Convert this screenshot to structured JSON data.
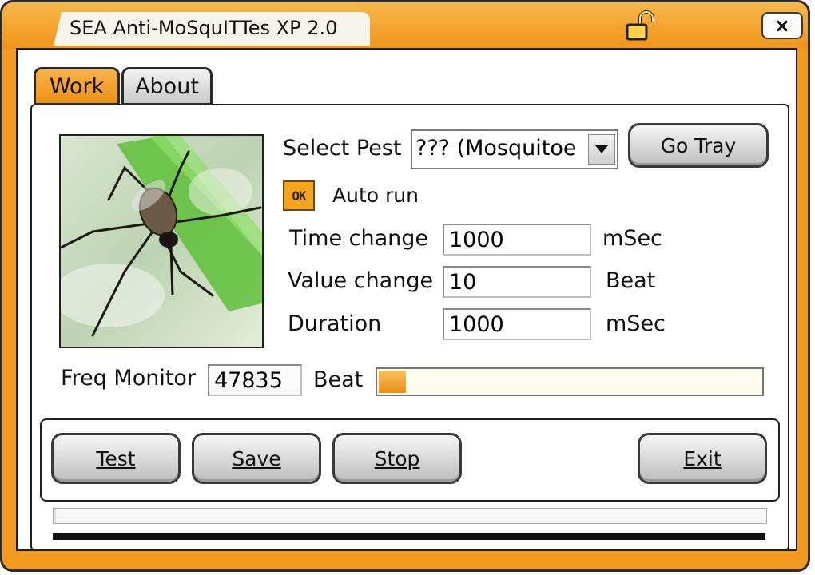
{
  "window": {
    "title": "SEA Anti-MoSquITTes XP 2.0",
    "close_label": "×"
  },
  "tabs": [
    {
      "label": "Work",
      "selected": true
    },
    {
      "label": "About",
      "selected": false
    }
  ],
  "work": {
    "select_pest": {
      "label": "Select Pest",
      "value": "??? (Mosquitoe"
    },
    "go_tray_label": "Go Tray",
    "auto_run": {
      "label": "Auto run",
      "checkbox_text": "OK",
      "checked": true
    },
    "time_change": {
      "label": "Time change",
      "value": "1000",
      "unit": "mSec"
    },
    "value_change": {
      "label": "Value change",
      "value": "10",
      "unit": "Beat"
    },
    "duration": {
      "label": "Duration",
      "value": "1000",
      "unit": "mSec"
    },
    "freq_monitor": {
      "label": "Freq Monitor",
      "value": "47835",
      "unit": "Beat",
      "level": 0.07
    }
  },
  "buttons": {
    "test": "Test",
    "save": "Save",
    "stop": "Stop",
    "exit": "Exit"
  },
  "bottom_progress": {
    "level": 0.003
  },
  "colors": {
    "accent": "#f39a1e",
    "accent_light": "#f8b24a"
  },
  "icons": {
    "lock": "lock-icon",
    "close": "close-icon",
    "dropdown": "chevron-down-icon"
  }
}
